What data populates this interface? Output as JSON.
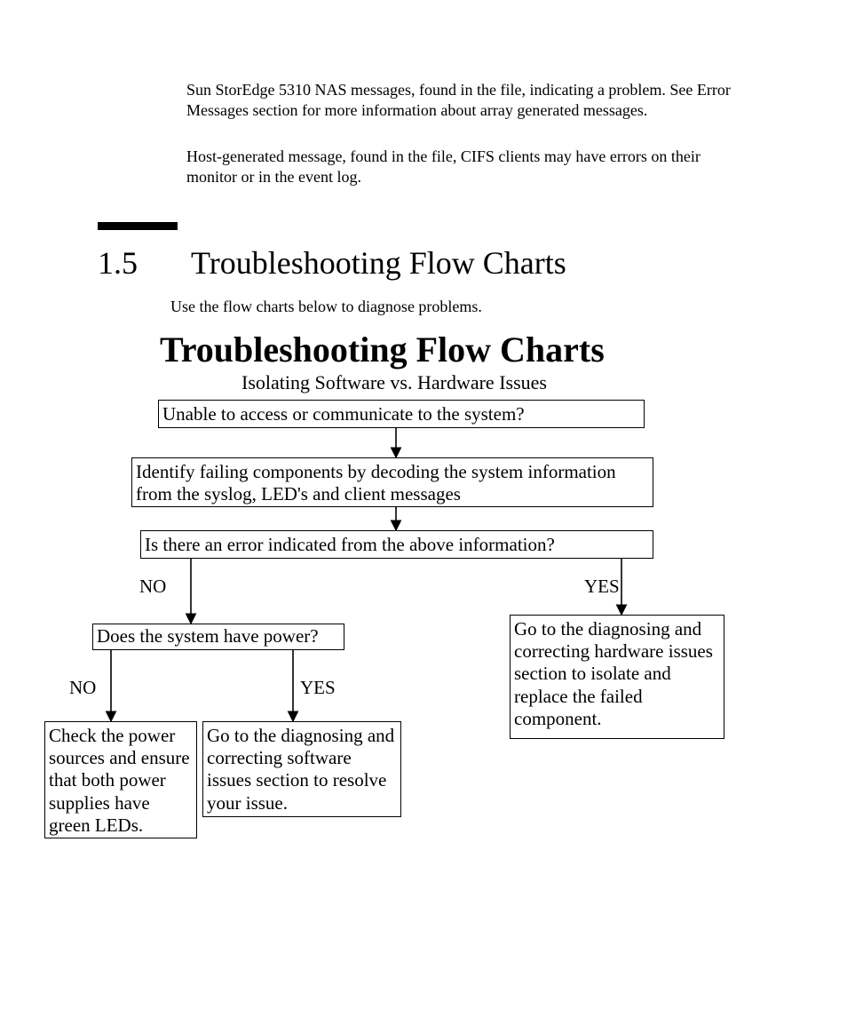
{
  "paragraphs": {
    "p1": "Sun StorEdge 5310 NAS messages, found in the                     file, indicating a problem. See Error Messages section for more information about array generated messages.",
    "p2": "Host-generated message, found in the                                                   file, CIFS clients may have errors on their monitor or in the event log."
  },
  "section": {
    "number": "1.5",
    "title": "Troubleshooting Flow Charts",
    "intro": "Use the flow charts below to diagnose problems."
  },
  "flowchart": {
    "title": "Troubleshooting Flow Charts",
    "subtitle": "Isolating Software vs. Hardware Issues",
    "boxes": {
      "q_access": "Unable to access or communicate to the system?",
      "identify": "Identify failing components by decoding the system information from the syslog, LED's and client messages",
      "q_error": "Is there an error indicated from the above information?",
      "q_power": "Does the system have power?",
      "hw_action": "Go to the diagnosing and correcting hardware issues section to isolate and replace the failed component.",
      "power_action": "Check the power sources and ensure that both power supplies have green LEDs.",
      "sw_action": "Go to the diagnosing and correcting software issues section to resolve your issue."
    },
    "labels": {
      "no": "NO",
      "yes": "YES"
    }
  }
}
